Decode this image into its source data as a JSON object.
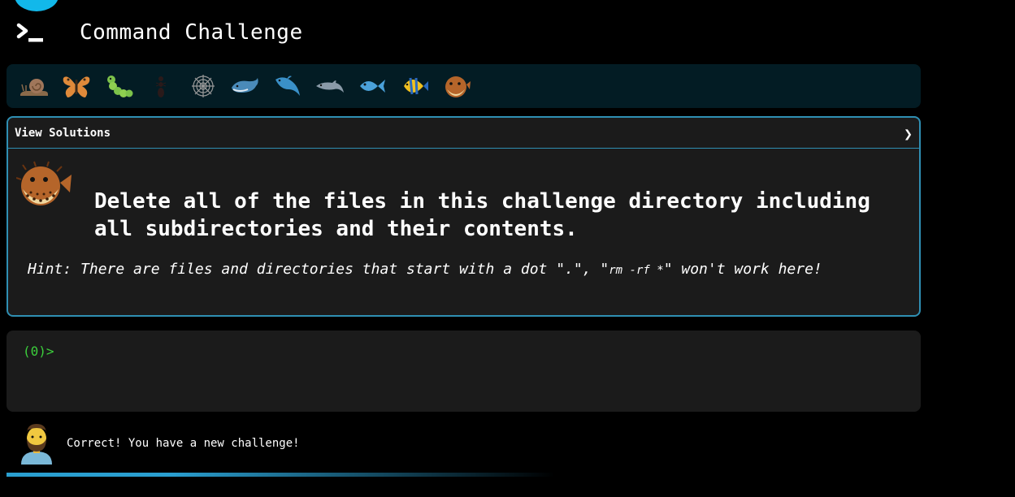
{
  "app": {
    "title": "Command Challenge",
    "accent_color": "#12b8ea",
    "logo_icon": "terminal-prompt-icon"
  },
  "levels": [
    {
      "name": "snail",
      "icon": "snail-icon"
    },
    {
      "name": "butterfly",
      "icon": "butterfly-icon"
    },
    {
      "name": "caterpillar",
      "icon": "caterpillar-icon"
    },
    {
      "name": "ant",
      "icon": "ant-icon"
    },
    {
      "name": "spider web",
      "icon": "spider-web-icon"
    },
    {
      "name": "whale",
      "icon": "whale-icon"
    },
    {
      "name": "spouting whale",
      "icon": "dolphin-jump-icon"
    },
    {
      "name": "dolphin",
      "icon": "dolphin-icon"
    },
    {
      "name": "fish",
      "icon": "fish-icon"
    },
    {
      "name": "tropical fish",
      "icon": "tropical-fish-icon"
    },
    {
      "name": "blowfish",
      "icon": "blowfish-icon"
    }
  ],
  "challenge": {
    "solutions_label": "View Solutions",
    "chevron": "❯",
    "icon": "blowfish-icon",
    "text": "Delete all of the files in this challenge directory including all subdirectories and their contents.",
    "hint_prefix": "Hint: There are files and directories that start with a dot \".\", \"",
    "hint_command": "rm -rf *",
    "hint_suffix": "\" won't work here!"
  },
  "terminal": {
    "prompt": "(0)>",
    "input_value": "",
    "prompt_color": "#3ccf3c"
  },
  "message": {
    "avatar_icon": "bearded-man-avatar-icon",
    "text": "Correct! You have a new challenge!"
  },
  "progress": {
    "fraction": 0.6,
    "color": "#2a9fd0"
  }
}
